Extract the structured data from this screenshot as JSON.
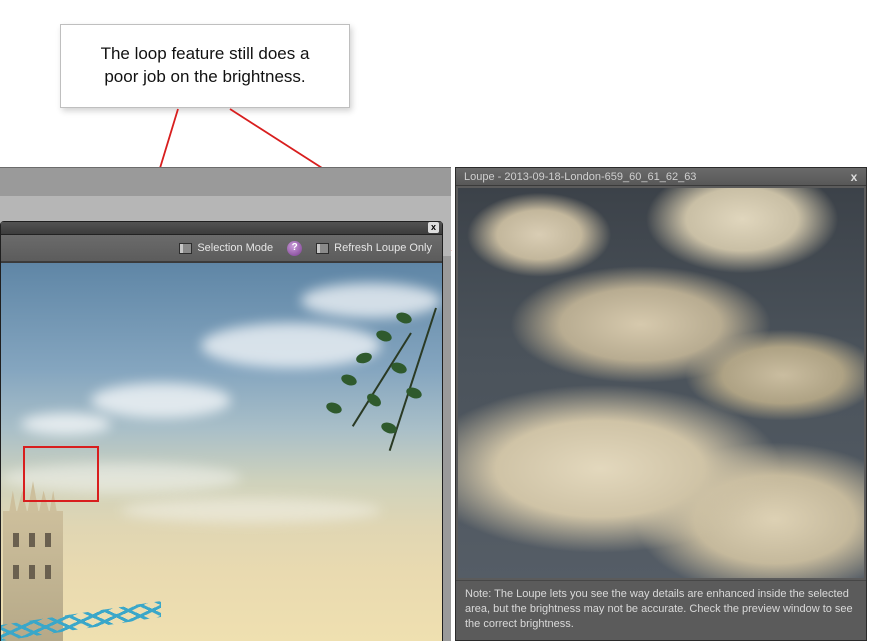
{
  "annotation": {
    "text": "The loop feature still does a poor job on the brightness."
  },
  "editor": {
    "toolbar": {
      "selection_mode_label": "Selection Mode",
      "help_symbol": "?",
      "refresh_loupe_label": "Refresh Loupe Only"
    },
    "close_symbol": "x"
  },
  "loupe": {
    "title": "Loupe - 2013-09-18-London-659_60_61_62_63",
    "close_symbol": "x",
    "note": "Note: The Loupe lets you see the way details are enhanced inside the selected area, but the brightness may not be accurate. Check the preview window to see the correct brightness."
  }
}
